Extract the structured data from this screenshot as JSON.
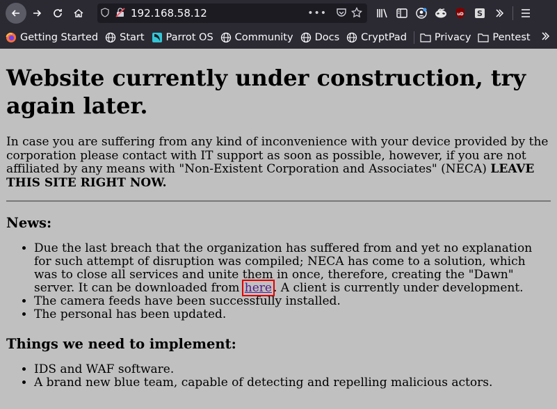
{
  "browser": {
    "url": "192.168.58.12"
  },
  "bookmarks": [
    {
      "label": "Getting Started"
    },
    {
      "label": "Start"
    },
    {
      "label": "Parrot OS"
    },
    {
      "label": "Community"
    },
    {
      "label": "Docs"
    },
    {
      "label": "CryptPad"
    },
    {
      "label": "Privacy"
    },
    {
      "label": "Pentest"
    }
  ],
  "page": {
    "title": "Website currently under construction, try again later.",
    "intro_text": "In case you are suffering from any kind of inconvenience with your device provided by the corporation please contact with IT support as soon as possible, however, if you are not affiliated by any means with \"Non-Existent Corporation and Associates\" (NECA) ",
    "intro_bold": "LEAVE THIS SITE RIGHT NOW.",
    "news_heading": "News:",
    "news": {
      "item1_before": "Due the last breach that the organization has suffered from and yet no explanation for such attempt of disruption was compiled; NECA has come to a solution, which was to close all services and unite them in once, therefore, creating the \"Dawn\" server. It can be downloaded from ",
      "item1_link": "here",
      "item1_after": ". A client is currently under development.",
      "item2": "The camera feeds have been successfully installed.",
      "item3": "The personal has been updated."
    },
    "needs_heading": "Things we need to implement:",
    "needs": {
      "item1": "IDS and WAF software.",
      "item2": "A brand new blue team, capable of detecting and repelling malicious actors."
    }
  }
}
